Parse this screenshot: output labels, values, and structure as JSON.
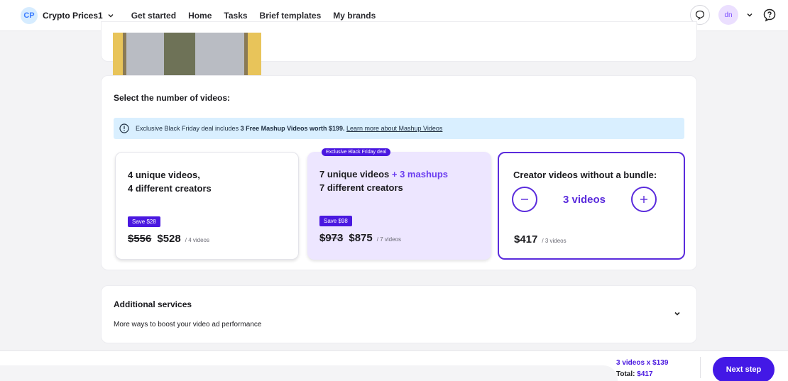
{
  "brand": {
    "initials": "CP",
    "name": "Crypto Prices1"
  },
  "nav": [
    "Get started",
    "Home",
    "Tasks",
    "Brief templates",
    "My brands"
  ],
  "user": {
    "initials": "dn"
  },
  "videos_section": {
    "title": "Select the number of videos:",
    "banner": {
      "prefix": "Exclusive Black Friday deal includes ",
      "bold": "3 Free Mashup Videos worth $199.",
      "link": "Learn more about Mashup Videos"
    },
    "options": [
      {
        "line1": "4 unique videos,",
        "line2": "4 different creators",
        "save": "Save $28",
        "old_price": "$556",
        "price": "$528",
        "unit": "/ 4 videos"
      },
      {
        "tag": "Exclusive Black Friday deal",
        "line1": "7 unique videos",
        "line1_accent": "+ 3 mashups",
        "line2": "7 different creators",
        "save": "Save $98",
        "old_price": "$973",
        "price": "$875",
        "unit": "/ 7 videos"
      }
    ],
    "custom": {
      "title": "Creator videos without a bundle:",
      "count": "3 videos",
      "price": "$417",
      "unit": "/ 3 videos"
    }
  },
  "services": {
    "title": "Additional services",
    "subtitle": "More ways to boost your video ad performance"
  },
  "footer": {
    "summary_line": "3 videos x $139",
    "total_label": "Total: ",
    "total_value": "$417",
    "next_label": "Next step"
  },
  "colors": {
    "accent": "#4318e6",
    "selected_border": "#5a2bdc",
    "highlight_bg": "#ede6ff",
    "banner_bg": "#d9efff"
  }
}
